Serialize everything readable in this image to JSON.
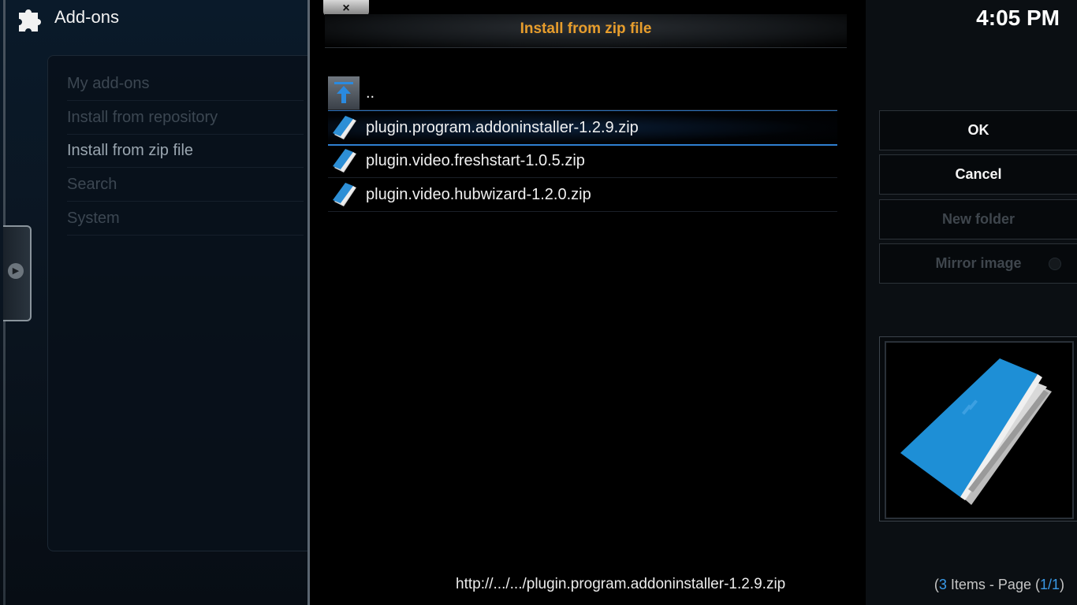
{
  "header": {
    "title": "Add-ons",
    "clock": "4:05 PM"
  },
  "menu": {
    "items": [
      {
        "label": "My add-ons"
      },
      {
        "label": "Install from repository"
      },
      {
        "label": "Install from zip file"
      },
      {
        "label": "Search"
      },
      {
        "label": "System"
      }
    ]
  },
  "dialog": {
    "title": "Install from zip file",
    "close_label": "×",
    "files": [
      {
        "label": "..",
        "icon": "parent-folder-icon"
      },
      {
        "label": "plugin.program.addoninstaller-1.2.9.zip",
        "icon": "zip-file-icon"
      },
      {
        "label": "plugin.video.freshstart-1.0.5.zip",
        "icon": "zip-file-icon"
      },
      {
        "label": "plugin.video.hubwizard-1.2.0.zip",
        "icon": "zip-file-icon"
      }
    ],
    "path": "http://.../.../plugin.program.addoninstaller-1.2.9.zip"
  },
  "buttons": {
    "ok": "OK",
    "cancel": "Cancel",
    "new_folder": "New folder",
    "mirror_image": "Mirror image"
  },
  "status": {
    "count": "3",
    "items_text": " Items - Page (",
    "page": "1/1",
    "open_paren": "(",
    "close_paren": ")"
  },
  "colors": {
    "accent": "#e79d2c",
    "selection": "#2f7fd0",
    "link": "#3a9ae8"
  }
}
